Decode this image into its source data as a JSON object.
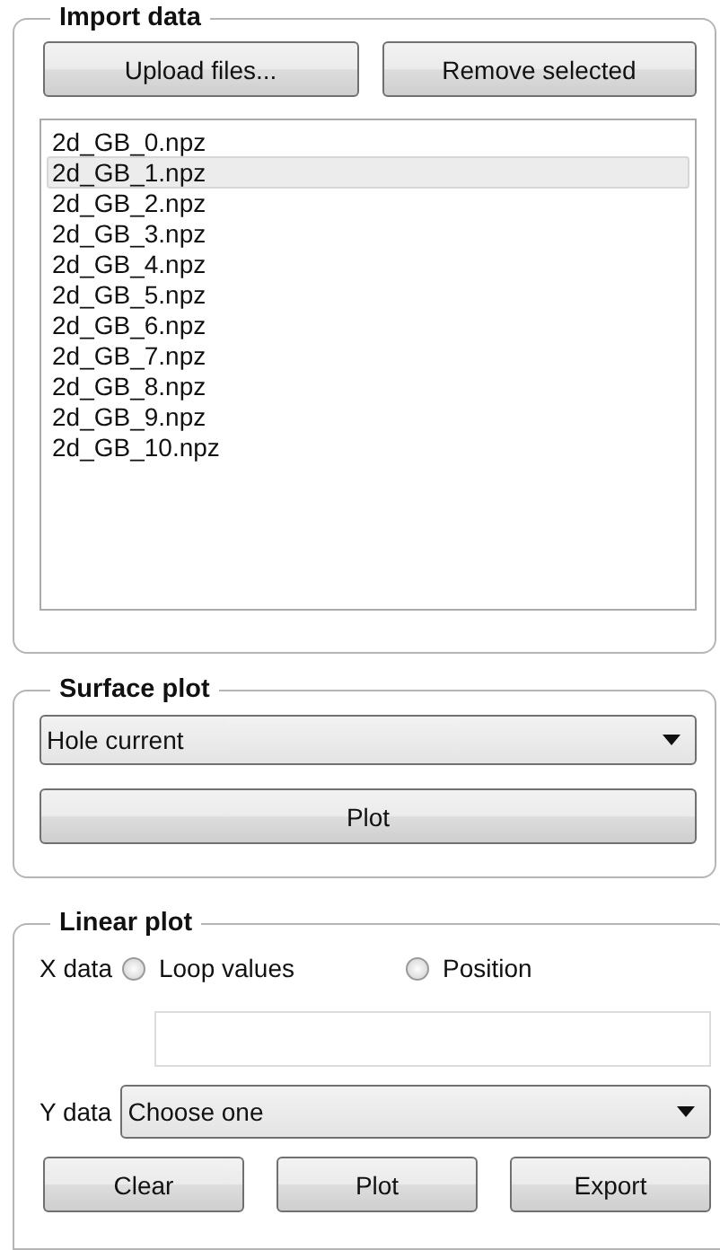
{
  "import_data": {
    "title": "Import data",
    "buttons": [
      "Upload files...",
      "Remove selected"
    ],
    "files": [
      {
        "name": "2d_GB_0.npz",
        "selected": false
      },
      {
        "name": "2d_GB_1.npz",
        "selected": true
      },
      {
        "name": "2d_GB_2.npz",
        "selected": false
      },
      {
        "name": "2d_GB_3.npz",
        "selected": false
      },
      {
        "name": "2d_GB_4.npz",
        "selected": false
      },
      {
        "name": "2d_GB_5.npz",
        "selected": false
      },
      {
        "name": "2d_GB_6.npz",
        "selected": false
      },
      {
        "name": "2d_GB_7.npz",
        "selected": false
      },
      {
        "name": "2d_GB_8.npz",
        "selected": false
      },
      {
        "name": "2d_GB_9.npz",
        "selected": false
      },
      {
        "name": "2d_GB_10.npz",
        "selected": false
      }
    ]
  },
  "surface_plot": {
    "title": "Surface plot",
    "dropdown": "Hole current",
    "button": "Plot"
  },
  "linear_plot": {
    "title": "Linear plot",
    "x_label": "X data",
    "x_options": [
      {
        "label": "Loop values",
        "selected": false
      },
      {
        "label": "Position",
        "selected": false
      }
    ],
    "y_label": "Y data",
    "y_dropdown": "Choose one",
    "buttons": [
      "Clear",
      "Plot",
      "Export"
    ]
  }
}
